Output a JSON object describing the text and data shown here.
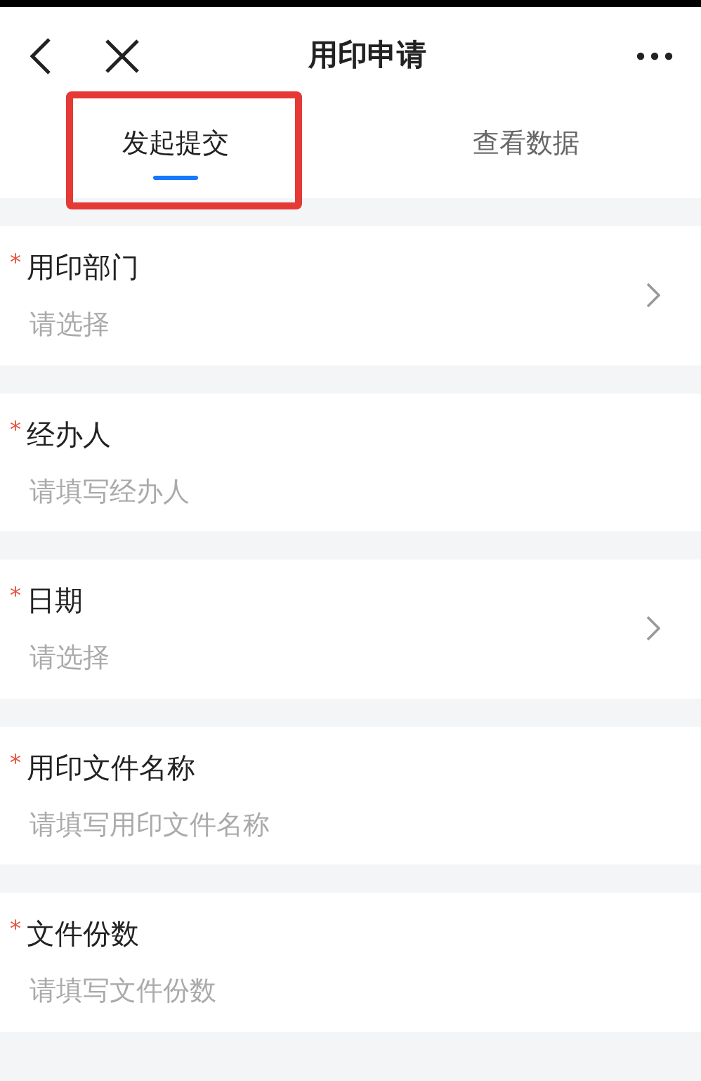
{
  "header": {
    "title": "用印申请"
  },
  "tabs": [
    {
      "label": "发起提交",
      "selected": true
    },
    {
      "label": "查看数据",
      "selected": false
    }
  ],
  "fields": [
    {
      "label": "用印部门",
      "required_mark": "*",
      "kind": "select",
      "placeholder": "请选择"
    },
    {
      "label": "经办人",
      "required_mark": "*",
      "kind": "input",
      "placeholder": "请填写经办人"
    },
    {
      "label": "日期",
      "required_mark": "*",
      "kind": "select",
      "placeholder": "请选择"
    },
    {
      "label": "用印文件名称",
      "required_mark": "*",
      "kind": "input",
      "placeholder": "请填写用印文件名称"
    },
    {
      "label": "文件份数",
      "required_mark": "*",
      "kind": "input",
      "placeholder": "请填写文件份数"
    }
  ]
}
